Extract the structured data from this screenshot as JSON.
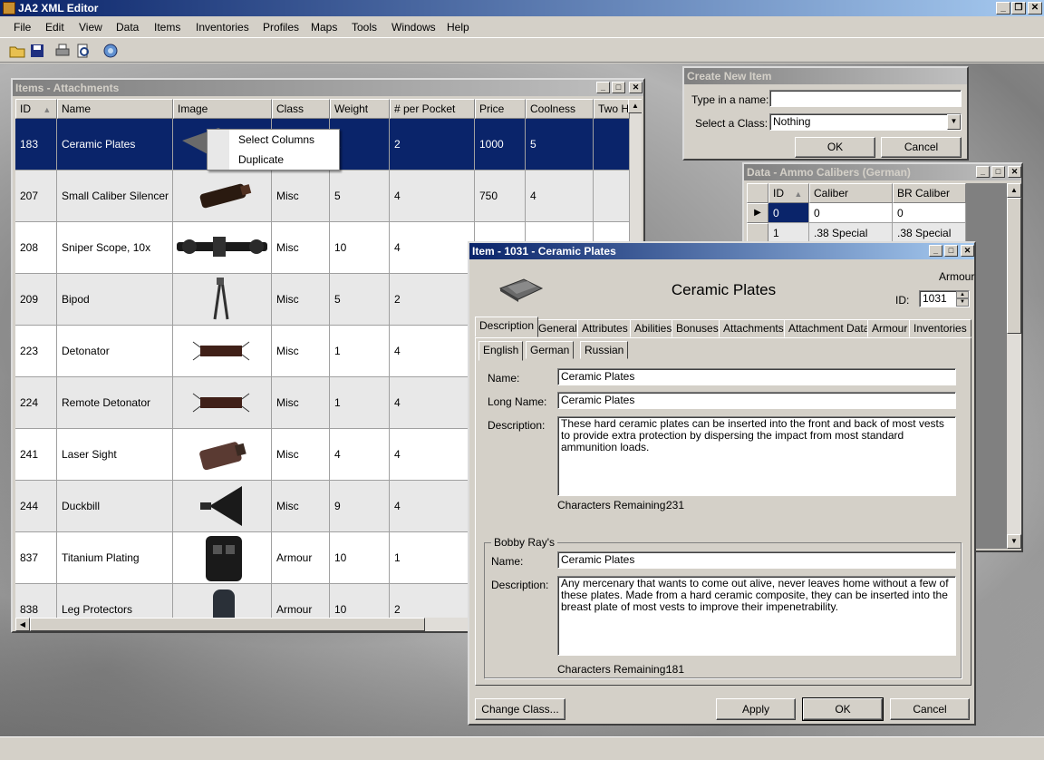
{
  "app": {
    "title": "JA2 XML Editor"
  },
  "menu": [
    "File",
    "Edit",
    "View",
    "Data",
    "Items",
    "Inventories",
    "Profiles",
    "Maps",
    "Tools",
    "Windows",
    "Help"
  ],
  "items_window": {
    "title": "Items - Attachments",
    "columns": [
      "ID",
      "Name",
      "Image",
      "Class",
      "Weight",
      "# per Pocket",
      "Price",
      "Coolness",
      "Two H"
    ],
    "rows": [
      {
        "id": "183",
        "name": "Ceramic Plates",
        "class": "",
        "weight": "2",
        "pocket": "2",
        "price": "1000",
        "cool": "5",
        "icon": "ceramic-plates-icon"
      },
      {
        "id": "207",
        "name": "Small Caliber Silencer",
        "class": "Misc",
        "weight": "5",
        "pocket": "4",
        "price": "750",
        "cool": "4",
        "icon": "silencer-icon"
      },
      {
        "id": "208",
        "name": "Sniper Scope, 10x",
        "class": "Misc",
        "weight": "10",
        "pocket": "4",
        "price": "",
        "cool": "",
        "icon": "scope-icon"
      },
      {
        "id": "209",
        "name": "Bipod",
        "class": "Misc",
        "weight": "5",
        "pocket": "2",
        "price": "",
        "cool": "",
        "icon": "bipod-icon"
      },
      {
        "id": "223",
        "name": "Detonator",
        "class": "Misc",
        "weight": "1",
        "pocket": "4",
        "price": "",
        "cool": "",
        "icon": "detonator-icon"
      },
      {
        "id": "224",
        "name": "Remote Detonator",
        "class": "Misc",
        "weight": "1",
        "pocket": "4",
        "price": "",
        "cool": "",
        "icon": "remote-detonator-icon"
      },
      {
        "id": "241",
        "name": "Laser Sight",
        "class": "Misc",
        "weight": "4",
        "pocket": "4",
        "price": "",
        "cool": "",
        "icon": "laser-sight-icon"
      },
      {
        "id": "244",
        "name": "Duckbill",
        "class": "Misc",
        "weight": "9",
        "pocket": "4",
        "price": "",
        "cool": "",
        "icon": "duckbill-icon"
      },
      {
        "id": "837",
        "name": "Titanium Plating",
        "class": "Armour",
        "weight": "10",
        "pocket": "1",
        "price": "",
        "cool": "",
        "icon": "titanium-plating-icon"
      },
      {
        "id": "838",
        "name": "Leg Protectors",
        "class": "Armour",
        "weight": "10",
        "pocket": "2",
        "price": "",
        "cool": "",
        "icon": "leg-protectors-icon"
      }
    ]
  },
  "context_menu": [
    "Select Columns",
    "Duplicate"
  ],
  "create_item": {
    "title": "Create New Item",
    "name_label": "Type in a name:",
    "name_value": "",
    "class_label": "Select a Class:",
    "class_value": "Nothing",
    "ok": "OK",
    "cancel": "Cancel"
  },
  "calibers": {
    "title": "Data - Ammo Calibers (German)",
    "columns": [
      "ID",
      "Caliber",
      "BR Caliber"
    ],
    "rows": [
      [
        "0",
        "0",
        "0"
      ],
      [
        "1",
        ".38 Special",
        ".38 Special"
      ]
    ]
  },
  "item_window": {
    "title": "Item - 1031 - Ceramic Plates",
    "class_name": "Armour",
    "item_name": "Ceramic Plates",
    "id_label": "ID:",
    "id_value": "1031",
    "tabs": [
      "Description",
      "General",
      "Attributes",
      "Abilities",
      "Bonuses",
      "Attachments",
      "Attachment Data",
      "Armour",
      "Inventories"
    ],
    "lang_tabs": [
      "English",
      "German",
      "Russian"
    ],
    "name_label": "Name:",
    "name_value": "Ceramic Plates",
    "long_name_label": "Long Name:",
    "long_name_value": "Ceramic Plates",
    "desc_label": "Description:",
    "desc_value": "These hard ceramic plates can be inserted into the front and back of most vests to provide extra protection by dispersing the impact from most standard ammunition loads.",
    "chars_label": "Characters Remaining:",
    "chars_value": "231",
    "br_group": "Bobby Ray's",
    "br_name_label": "Name:",
    "br_name_value": "Ceramic Plates",
    "br_desc_label": "Description:",
    "br_desc_value": "Any mercenary that wants to come out alive, never leaves home without a few of these plates. Made from a hard ceramic composite, they can be inserted into the breast plate of most vests to improve their impenetrability.",
    "br_chars_label": "Characters Remaining:",
    "br_chars_value": "181",
    "change_class": "Change Class...",
    "apply": "Apply",
    "ok": "OK",
    "cancel": "Cancel"
  }
}
